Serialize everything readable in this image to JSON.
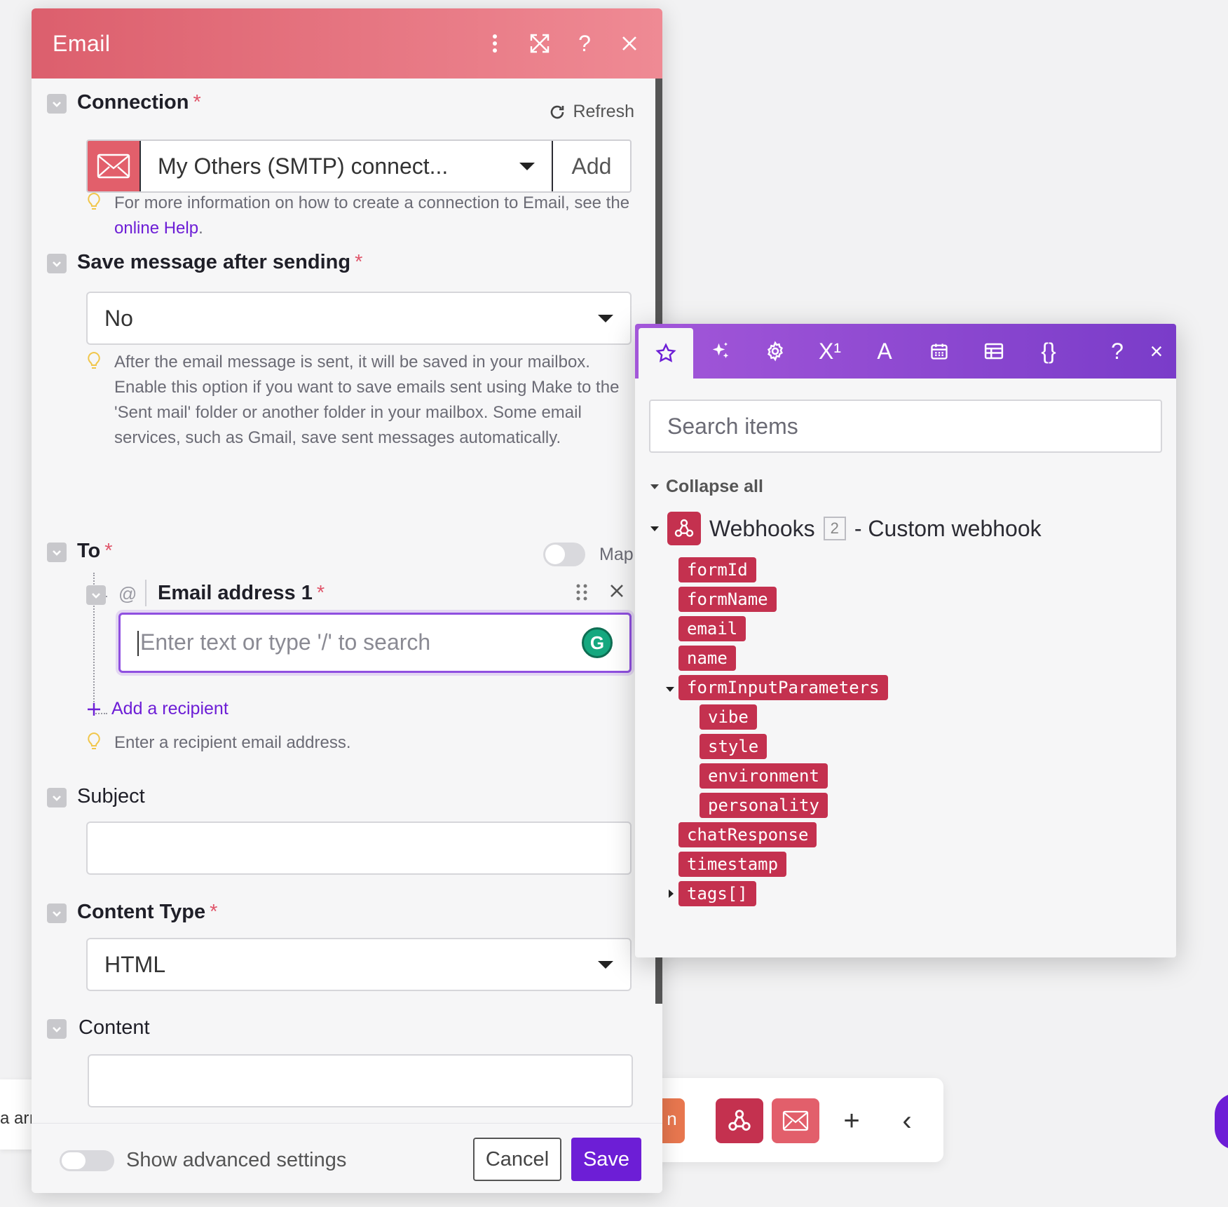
{
  "email_panel": {
    "title": "Email",
    "connection": {
      "label": "Connection",
      "required_mark": "*",
      "refresh_label": "Refresh",
      "selected": "My Others (SMTP) connect...",
      "add_label": "Add",
      "hint_text": "For more information on how to create a connection to Email, see the ",
      "hint_link": "online Help",
      "hint_end": "."
    },
    "save_message": {
      "label": "Save message after sending",
      "required_mark": "*",
      "selected": "No",
      "hint": "After the email message is sent, it will be saved in your mailbox. Enable this option if you want to save emails sent using Make to the 'Sent mail' folder or another folder in your mailbox. Some email services, such as Gmail, save sent messages automatically."
    },
    "to": {
      "label": "To",
      "required_mark": "*",
      "map_label": "Map",
      "at_symbol": "@",
      "email_address_label": "Email address 1",
      "email_placeholder": "Enter text or type '/' to search",
      "add_recipient": "Add a recipient",
      "hint": "Enter a recipient email address."
    },
    "subject": {
      "label": "Subject"
    },
    "content_type": {
      "label": "Content Type",
      "required_mark": "*",
      "selected": "HTML"
    },
    "content": {
      "label": "Content"
    },
    "footer": {
      "advanced_label": "Show advanced settings",
      "cancel_label": "Cancel",
      "save_label": "Save"
    }
  },
  "mapping_panel": {
    "toolbar_icons": [
      "star-icon",
      "sparkle-icon",
      "gear-icon",
      "superscript-icon",
      "text-icon",
      "calendar-icon",
      "table-icon",
      "braces-icon",
      "help-icon",
      "close-icon"
    ],
    "superscript_label": "X¹",
    "text_label": "A",
    "braces_label": "{}",
    "help_label": "?",
    "close_label": "×",
    "search_placeholder": "Search items",
    "collapse_all": "Collapse all",
    "module": {
      "name": "Webhooks",
      "count": "2",
      "subtitle": "- Custom webhook"
    },
    "items": [
      "formId",
      "formName",
      "email",
      "name",
      "formInputParameters",
      "vibe",
      "style",
      "environment",
      "personality",
      "chatResponse",
      "timestamp",
      "tags[]"
    ]
  },
  "background": {
    "left_text": "a arı",
    "orange_letter": "n",
    "plus": "+",
    "back": "‹"
  },
  "colors": {
    "header_gradient_start": "#dc5f6d",
    "header_gradient_end": "#ef8a94",
    "accent_purple": "#6d1ed6",
    "tag_red": "#c4314f",
    "email_icon_red": "#e25f6b"
  }
}
